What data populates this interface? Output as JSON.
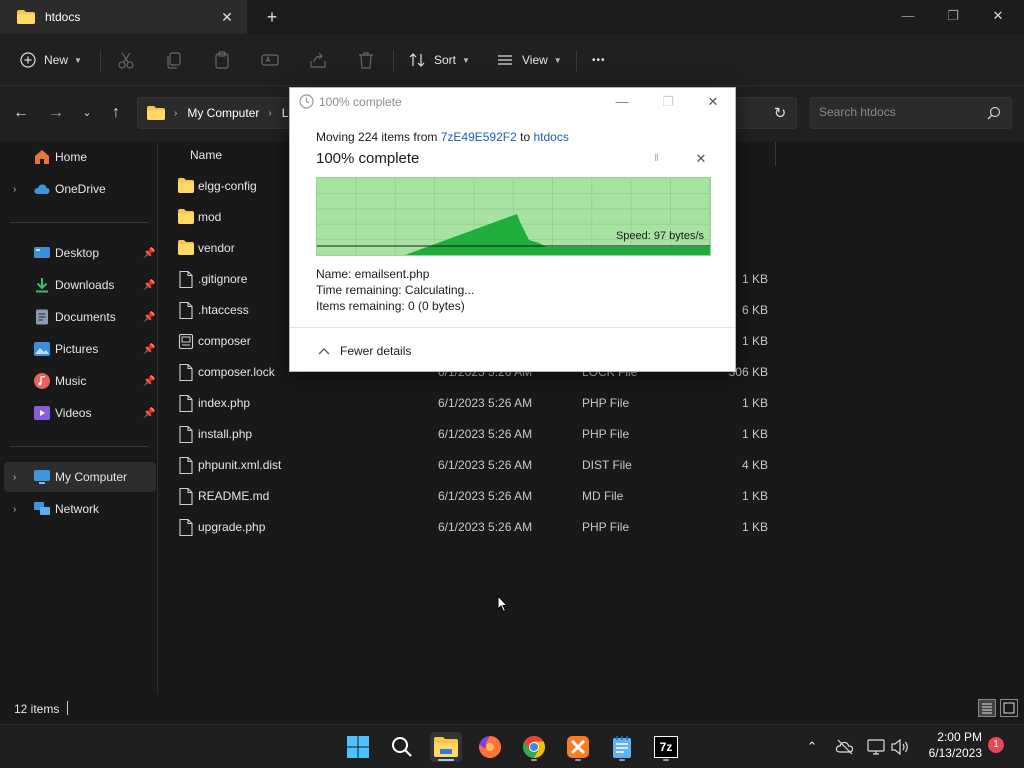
{
  "window": {
    "tab_title": "htdocs",
    "controls": {
      "minimize": "—",
      "maximize": "❐",
      "close": "✕"
    }
  },
  "toolbar": {
    "new_label": "New",
    "sort_label": "Sort",
    "view_label": "View",
    "more_label": "•••"
  },
  "address": {
    "crumbs": [
      "My Computer",
      "Lo"
    ],
    "search_placeholder": "Search htdocs"
  },
  "sidebar": {
    "items": [
      {
        "label": "Home",
        "icon": "home-icon",
        "color": "#e8743b"
      },
      {
        "label": "OneDrive",
        "icon": "cloud-icon",
        "color": "#3a96dd"
      },
      {
        "label": "Desktop",
        "icon": "desktop-icon",
        "color": "#3a8fd8",
        "pinned": true
      },
      {
        "label": "Downloads",
        "icon": "download-icon",
        "color": "#3fbf6b",
        "pinned": true
      },
      {
        "label": "Documents",
        "icon": "document-icon",
        "color": "#8a9bb4",
        "pinned": true
      },
      {
        "label": "Pictures",
        "icon": "pictures-icon",
        "color": "#3a8fd8",
        "pinned": true
      },
      {
        "label": "Music",
        "icon": "music-icon",
        "color": "#e8615a",
        "pinned": true
      },
      {
        "label": "Videos",
        "icon": "videos-icon",
        "color": "#8c5bd9",
        "pinned": true
      },
      {
        "label": "My Computer",
        "icon": "computer-icon",
        "color": "#3a96dd"
      },
      {
        "label": "Network",
        "icon": "network-icon",
        "color": "#3a96dd"
      }
    ]
  },
  "file_list": {
    "header_name": "Name",
    "rows": [
      {
        "name": "elgg-config",
        "kind": "folder",
        "date": "",
        "type": "",
        "size": ""
      },
      {
        "name": "mod",
        "kind": "folder",
        "date": "",
        "type": "",
        "size": ""
      },
      {
        "name": "vendor",
        "kind": "folder",
        "date": "",
        "type": "",
        "size": ""
      },
      {
        "name": ".gitignore",
        "kind": "file",
        "date": "",
        "type": "",
        "size": "1 KB"
      },
      {
        "name": ".htaccess",
        "kind": "file",
        "date": "",
        "type": "",
        "size": "6 KB"
      },
      {
        "name": "composer",
        "kind": "script",
        "date": "",
        "type": "",
        "size": "1 KB"
      },
      {
        "name": "composer.lock",
        "kind": "file",
        "date": "6/1/2023 5:26 AM",
        "type": "LOCK File",
        "size": "306 KB"
      },
      {
        "name": "index.php",
        "kind": "file",
        "date": "6/1/2023 5:26 AM",
        "type": "PHP File",
        "size": "1 KB"
      },
      {
        "name": "install.php",
        "kind": "file",
        "date": "6/1/2023 5:26 AM",
        "type": "PHP File",
        "size": "1 KB"
      },
      {
        "name": "phpunit.xml.dist",
        "kind": "file",
        "date": "6/1/2023 5:26 AM",
        "type": "DIST File",
        "size": "4 KB"
      },
      {
        "name": "README.md",
        "kind": "file",
        "date": "6/1/2023 5:26 AM",
        "type": "MD File",
        "size": "1 KB"
      },
      {
        "name": "upgrade.php",
        "kind": "file",
        "date": "6/1/2023 5:26 AM",
        "type": "PHP File",
        "size": "1 KB"
      }
    ]
  },
  "status": {
    "item_count": "12 items"
  },
  "dialog": {
    "title": "100% complete",
    "moving_prefix": "Moving 224 items from ",
    "source": "7zE49E592F2",
    "moving_mid": " to ",
    "destination": "htdocs",
    "big_status": "100% complete",
    "pause_label": "II",
    "cancel_label": "✕",
    "progress_percent": 100,
    "speed": "Speed: 97 bytes/s",
    "name_line": "Name:  emailsent.php",
    "time_line": "Time remaining:  Calculating...",
    "items_line": "Items remaining:  0 (0 bytes)",
    "fewer_details": "Fewer details",
    "colors": {
      "fill": "#a6e3a1",
      "series": "#1fae3c",
      "grid": "#8fd08f"
    }
  },
  "taskbar": {
    "apps": [
      {
        "name": "start",
        "icon": "windows-icon"
      },
      {
        "name": "search",
        "icon": "search-icon"
      },
      {
        "name": "file-explorer",
        "icon": "folder-icon",
        "active": true
      },
      {
        "name": "firefox",
        "icon": "firefox-icon"
      },
      {
        "name": "chrome",
        "icon": "chrome-icon"
      },
      {
        "name": "xampp",
        "icon": "xampp-icon"
      },
      {
        "name": "notepad",
        "icon": "notepad-icon"
      },
      {
        "name": "7zip",
        "icon": "7zip-icon",
        "label": "7z"
      }
    ],
    "time": "2:00 PM",
    "date": "6/13/2023",
    "notification_count": "1"
  }
}
